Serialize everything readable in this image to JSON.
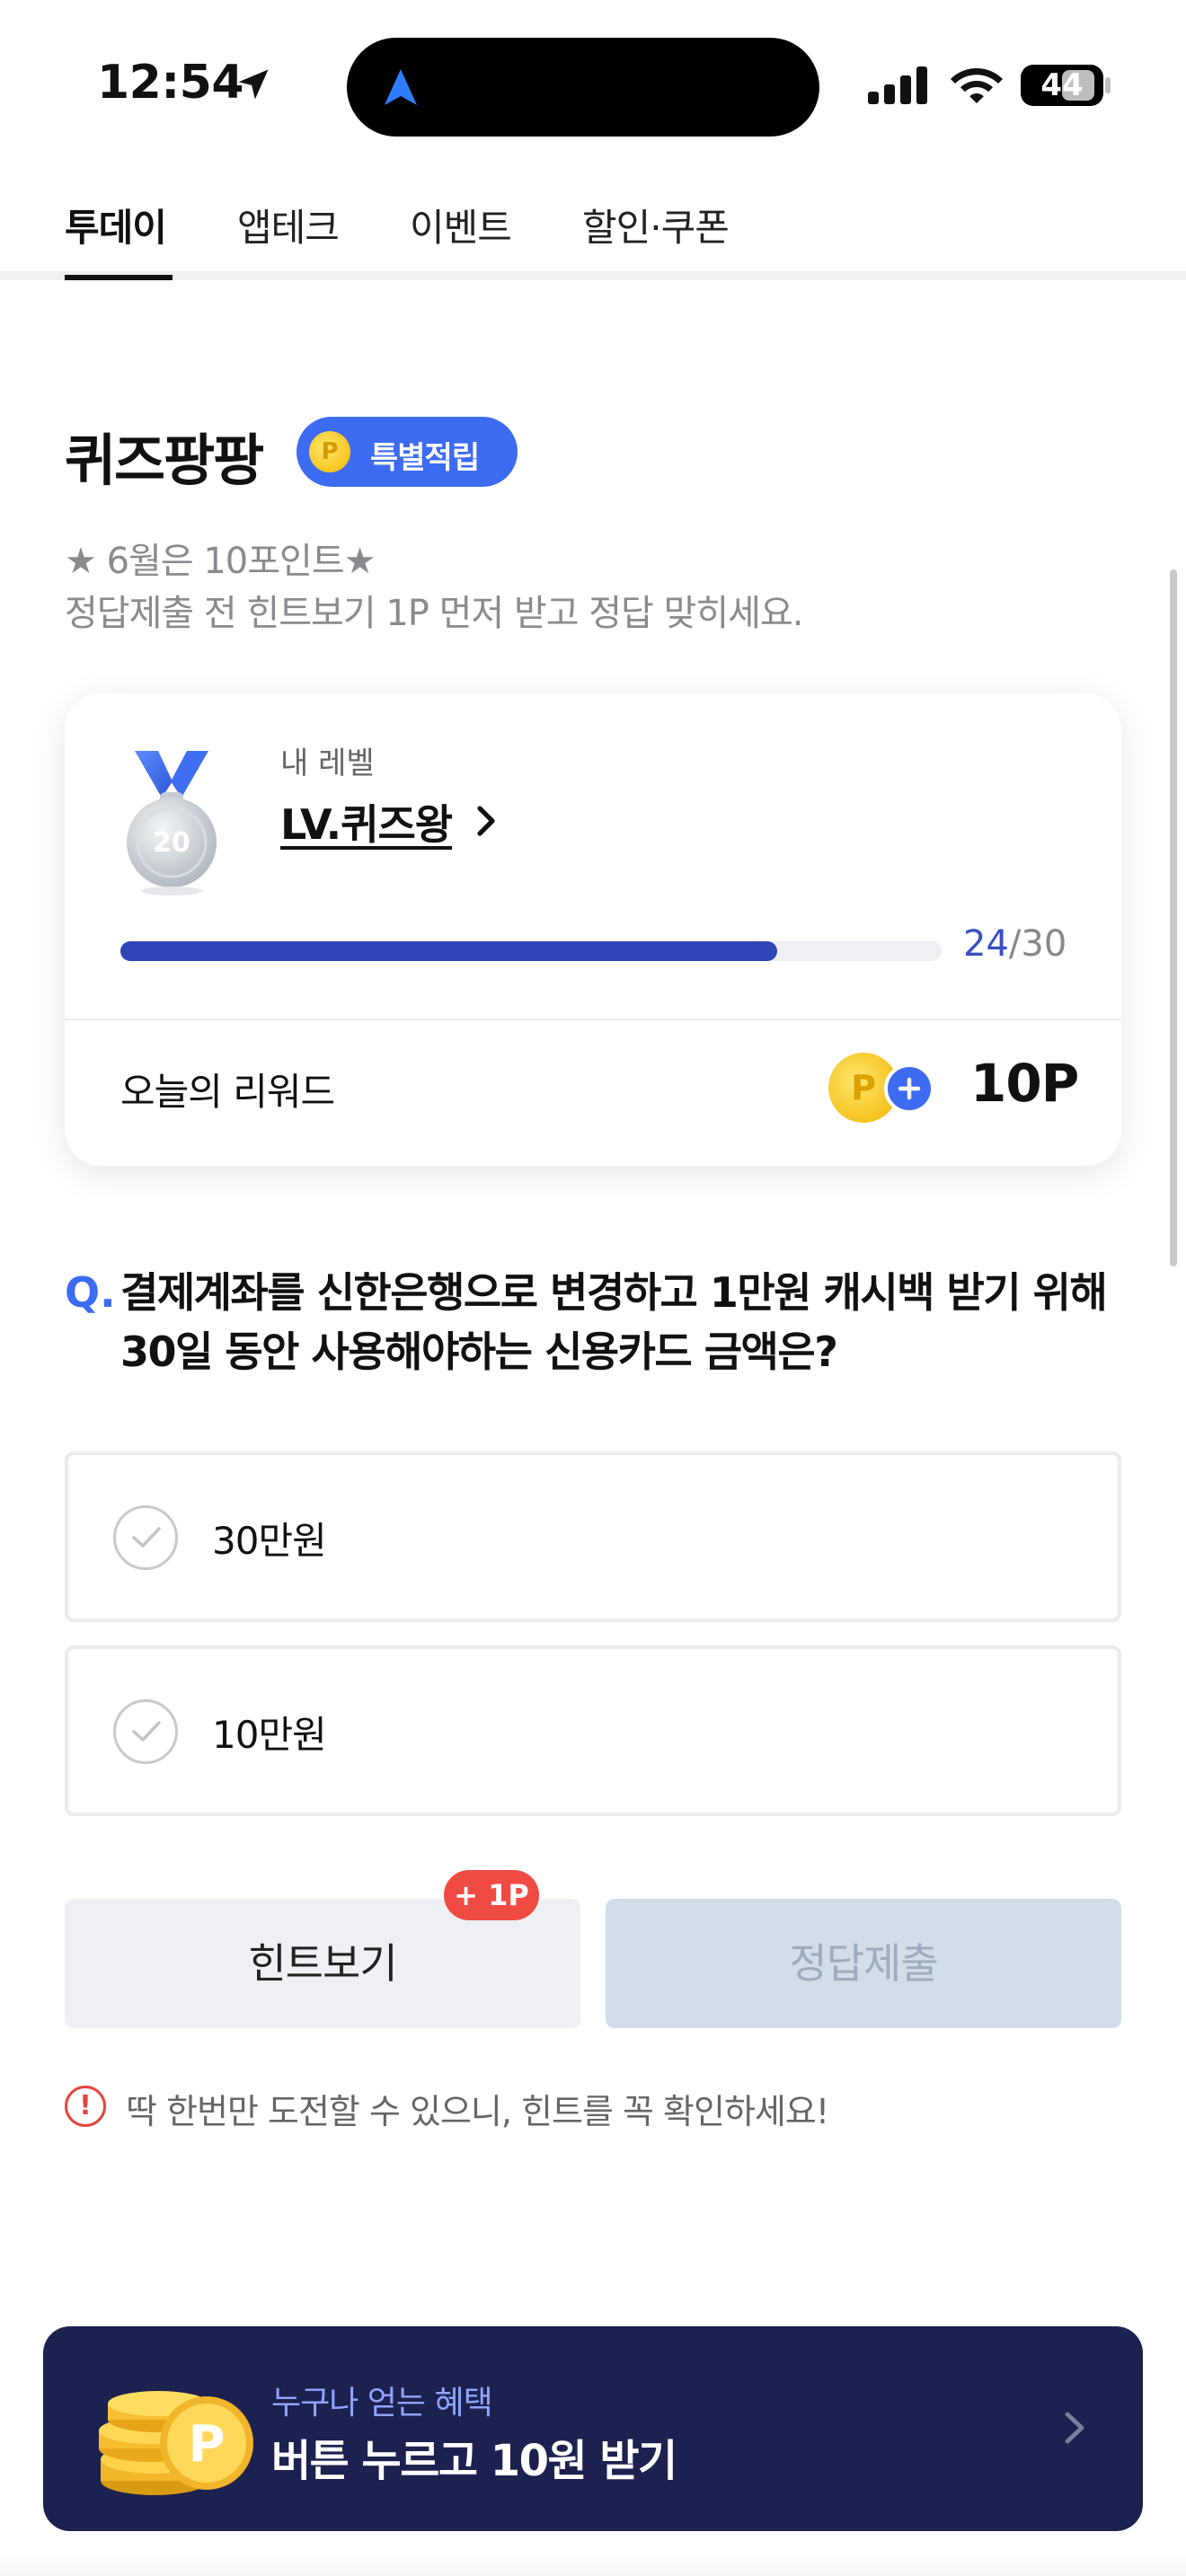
{
  "status_bar": {
    "time": "12:54",
    "battery": "44"
  },
  "tabs": [
    {
      "label": "투데이",
      "active": true
    },
    {
      "label": "앱테크",
      "active": false
    },
    {
      "label": "이벤트",
      "active": false
    },
    {
      "label": "할인·쿠폰",
      "active": false
    }
  ],
  "quiz": {
    "title": "퀴즈팡팡",
    "badge_label": "특별적립",
    "coin_symbol": "P",
    "subtitle_line1": "★ 6월은 10포인트★",
    "subtitle_line2": "정답제출 전 힌트보기 1P 먼저 받고 정답 맞히세요."
  },
  "level_card": {
    "medal_number": "20",
    "caption": "내 레벨",
    "level_name": "LV.퀴즈왕",
    "progress_current": "24",
    "progress_total": "/30",
    "progress_fraction": 0.8,
    "reward_label": "오늘의 리워드",
    "reward_value": "10P"
  },
  "question": {
    "mark": "Q.",
    "text": "결제계좌를 신한은행으로 변경하고 1만원 캐시백 받기 위해 30일 동안 사용해야하는 신용카드 금액은?"
  },
  "options": [
    {
      "label": "30만원"
    },
    {
      "label": "10만원"
    }
  ],
  "buttons": {
    "hint_label": "힌트보기",
    "hint_badge": "+ 1P",
    "submit_label": "정답제출"
  },
  "warning": {
    "icon": "!",
    "text": "딱 한번만 도전할 수 있으니, 힌트를 꼭 확인하세요!"
  },
  "banner": {
    "caption": "누구나 얻는 혜택",
    "title": "버튼 누르고 10원 받기"
  },
  "colors": {
    "accent": "#3d6bf2",
    "progress": "#2f46b8",
    "banner_bg": "#1d2150",
    "badge_red": "#f04b42"
  }
}
